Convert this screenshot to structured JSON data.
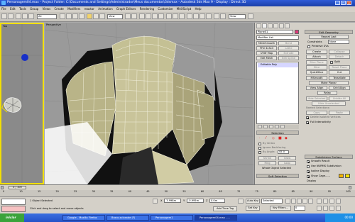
{
  "window": {
    "title": "Personagem04.max - Project Folder: C:\\Documents and Settings\\Administrador\\Meus documentos\\3dsmax - Autodesk 3ds Max 9 - Display : Direct 3D"
  },
  "menu": [
    "File",
    "Edit",
    "Tools",
    "Group",
    "Views",
    "Create",
    "Modifiers",
    "reactor",
    "Animation",
    "Graph Editors",
    "Rendering",
    "Customize",
    "MAXScript",
    "Help"
  ],
  "toolbar": {
    "selection_filter": "All",
    "ref_coord": "View",
    "named_selection": "View"
  },
  "viewports": {
    "left_label": "Top",
    "main_label": "Perspective"
  },
  "command_panel": {
    "object_name": "Plane01",
    "modifier_list": "Modifier List",
    "mod_buttons": [
      "MeshSmooth",
      "Bend",
      "FFD 3x3x3",
      "Lathe",
      "UVW Map",
      "Extrude",
      "Edit Mesh",
      "Edit Spline"
    ],
    "stack_item": "Editable Poly",
    "selection_header": "Selection",
    "selection_options": {
      "by_vertex": "By Vertex",
      "ignore_backfacing": "Ignore Backfacing",
      "by_angle": "By Angle:",
      "angle_value": "45.0",
      "shrink": "Shrink",
      "grow": "Grow",
      "ring": "Ring",
      "loop": "Loop",
      "whole_object": "Whole Object Selected"
    },
    "soft_selection": "Soft Selection",
    "edit_geometry": {
      "header": "Edit Geometry",
      "repeat_last": "Repeat Last",
      "constraints": "Constraints",
      "constraints_value": "None",
      "preserve_uvs": "Preserve UVs",
      "create": "Create",
      "collapse": "Collapse",
      "attach": "Attach",
      "detach": "Detach",
      "slice_plane": "Slice Plane",
      "split": "Split",
      "slice": "Slice",
      "reset_plane": "Reset Plane",
      "quickslice": "QuickSlice",
      "cut": "Cut",
      "msmooth": "MSmooth",
      "tessellate": "Tessellate",
      "make_planar": "Make Planar",
      "view_align": "View Align",
      "grid_align": "Grid Align",
      "relax": "Relax",
      "hide_selected": "Hide Selected",
      "unhide_all": "Unhide All",
      "hide_unselected": "Hide Unselected",
      "named_selections": "Named Selections:",
      "copy": "Copy",
      "paste": "Paste",
      "delete_isolated": "Delete Isolated Vertices",
      "full_interactivity": "Full Interactivity"
    },
    "subdivision": {
      "header": "Subdivision Surface",
      "smooth_result": "Smooth Result",
      "use_nurms": "Use NURMS Subdivision",
      "isoline": "Isoline Display",
      "show_cage": "Show Cage......",
      "display": "Display",
      "iterations_label": "Iterations:",
      "iterations_value": "1",
      "smoothness_label": "Smoothness:",
      "smoothness_value": "1.0"
    }
  },
  "timeline": {
    "frame_readout": "0 / 100"
  },
  "ruler_ticks": [
    "0",
    "10",
    "15",
    "20",
    "25",
    "30",
    "35",
    "40",
    "45",
    "50",
    "55",
    "60",
    "65",
    "70",
    "75",
    "80",
    "85",
    "90",
    "95",
    "100"
  ],
  "status": {
    "selected": "1 Object Selected",
    "prompt": "Click and drag to select and move objects",
    "x_label": "X",
    "x_value": "-3.998m",
    "y_label": "Y",
    "y_value": "-0.995m",
    "z_label": "Z",
    "z_value": "0.0m",
    "add_time_tag": "Add Time Tag",
    "auto_key": "Auto Key",
    "set_key": "Set Key",
    "key_mode": "Selected",
    "key_filters": "Key Filters...",
    "frame": "0"
  },
  "taskbar": {
    "start": "iniciar",
    "tasks": [
      "Google - Mozilla Firefox",
      "Braco-sclosabe (F)",
      "Personagem1",
      "Personagem04.max - ..."
    ],
    "clock": "00:00"
  },
  "colors": {
    "viewport_border": "#f3e000",
    "mesh_color": "#c4c094",
    "wire_color": "#f2f0dd",
    "sphere": "#1830c8",
    "title_bar": "#2e5bd8"
  }
}
